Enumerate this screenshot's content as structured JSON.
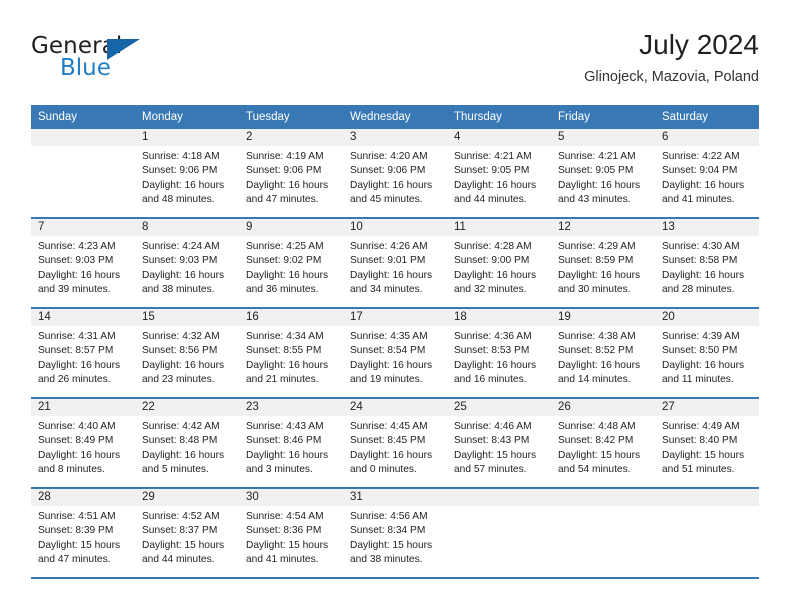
{
  "brand": {
    "name_part1": "General",
    "name_part2": "Blue",
    "triangle_color": "#1565a8",
    "blue_color": "#1f7fc6"
  },
  "header": {
    "title": "July 2024",
    "location": "Glinojeck, Mazovia, Poland"
  },
  "theme": {
    "header_blue": "#3878b4",
    "daynum_band": "#f1f1f1",
    "text": "#231f20"
  },
  "weekday_headers": [
    "Sunday",
    "Monday",
    "Tuesday",
    "Wednesday",
    "Thursday",
    "Friday",
    "Saturday"
  ],
  "weeks": [
    [
      {
        "day": "",
        "lines": []
      },
      {
        "day": "1",
        "lines": [
          "Sunrise: 4:18 AM",
          "Sunset: 9:06 PM",
          "Daylight: 16 hours",
          "and 48 minutes."
        ]
      },
      {
        "day": "2",
        "lines": [
          "Sunrise: 4:19 AM",
          "Sunset: 9:06 PM",
          "Daylight: 16 hours",
          "and 47 minutes."
        ]
      },
      {
        "day": "3",
        "lines": [
          "Sunrise: 4:20 AM",
          "Sunset: 9:06 PM",
          "Daylight: 16 hours",
          "and 45 minutes."
        ]
      },
      {
        "day": "4",
        "lines": [
          "Sunrise: 4:21 AM",
          "Sunset: 9:05 PM",
          "Daylight: 16 hours",
          "and 44 minutes."
        ]
      },
      {
        "day": "5",
        "lines": [
          "Sunrise: 4:21 AM",
          "Sunset: 9:05 PM",
          "Daylight: 16 hours",
          "and 43 minutes."
        ]
      },
      {
        "day": "6",
        "lines": [
          "Sunrise: 4:22 AM",
          "Sunset: 9:04 PM",
          "Daylight: 16 hours",
          "and 41 minutes."
        ]
      }
    ],
    [
      {
        "day": "7",
        "lines": [
          "Sunrise: 4:23 AM",
          "Sunset: 9:03 PM",
          "Daylight: 16 hours",
          "and 39 minutes."
        ]
      },
      {
        "day": "8",
        "lines": [
          "Sunrise: 4:24 AM",
          "Sunset: 9:03 PM",
          "Daylight: 16 hours",
          "and 38 minutes."
        ]
      },
      {
        "day": "9",
        "lines": [
          "Sunrise: 4:25 AM",
          "Sunset: 9:02 PM",
          "Daylight: 16 hours",
          "and 36 minutes."
        ]
      },
      {
        "day": "10",
        "lines": [
          "Sunrise: 4:26 AM",
          "Sunset: 9:01 PM",
          "Daylight: 16 hours",
          "and 34 minutes."
        ]
      },
      {
        "day": "11",
        "lines": [
          "Sunrise: 4:28 AM",
          "Sunset: 9:00 PM",
          "Daylight: 16 hours",
          "and 32 minutes."
        ]
      },
      {
        "day": "12",
        "lines": [
          "Sunrise: 4:29 AM",
          "Sunset: 8:59 PM",
          "Daylight: 16 hours",
          "and 30 minutes."
        ]
      },
      {
        "day": "13",
        "lines": [
          "Sunrise: 4:30 AM",
          "Sunset: 8:58 PM",
          "Daylight: 16 hours",
          "and 28 minutes."
        ]
      }
    ],
    [
      {
        "day": "14",
        "lines": [
          "Sunrise: 4:31 AM",
          "Sunset: 8:57 PM",
          "Daylight: 16 hours",
          "and 26 minutes."
        ]
      },
      {
        "day": "15",
        "lines": [
          "Sunrise: 4:32 AM",
          "Sunset: 8:56 PM",
          "Daylight: 16 hours",
          "and 23 minutes."
        ]
      },
      {
        "day": "16",
        "lines": [
          "Sunrise: 4:34 AM",
          "Sunset: 8:55 PM",
          "Daylight: 16 hours",
          "and 21 minutes."
        ]
      },
      {
        "day": "17",
        "lines": [
          "Sunrise: 4:35 AM",
          "Sunset: 8:54 PM",
          "Daylight: 16 hours",
          "and 19 minutes."
        ]
      },
      {
        "day": "18",
        "lines": [
          "Sunrise: 4:36 AM",
          "Sunset: 8:53 PM",
          "Daylight: 16 hours",
          "and 16 minutes."
        ]
      },
      {
        "day": "19",
        "lines": [
          "Sunrise: 4:38 AM",
          "Sunset: 8:52 PM",
          "Daylight: 16 hours",
          "and 14 minutes."
        ]
      },
      {
        "day": "20",
        "lines": [
          "Sunrise: 4:39 AM",
          "Sunset: 8:50 PM",
          "Daylight: 16 hours",
          "and 11 minutes."
        ]
      }
    ],
    [
      {
        "day": "21",
        "lines": [
          "Sunrise: 4:40 AM",
          "Sunset: 8:49 PM",
          "Daylight: 16 hours",
          "and 8 minutes."
        ]
      },
      {
        "day": "22",
        "lines": [
          "Sunrise: 4:42 AM",
          "Sunset: 8:48 PM",
          "Daylight: 16 hours",
          "and 5 minutes."
        ]
      },
      {
        "day": "23",
        "lines": [
          "Sunrise: 4:43 AM",
          "Sunset: 8:46 PM",
          "Daylight: 16 hours",
          "and 3 minutes."
        ]
      },
      {
        "day": "24",
        "lines": [
          "Sunrise: 4:45 AM",
          "Sunset: 8:45 PM",
          "Daylight: 16 hours",
          "and 0 minutes."
        ]
      },
      {
        "day": "25",
        "lines": [
          "Sunrise: 4:46 AM",
          "Sunset: 8:43 PM",
          "Daylight: 15 hours",
          "and 57 minutes."
        ]
      },
      {
        "day": "26",
        "lines": [
          "Sunrise: 4:48 AM",
          "Sunset: 8:42 PM",
          "Daylight: 15 hours",
          "and 54 minutes."
        ]
      },
      {
        "day": "27",
        "lines": [
          "Sunrise: 4:49 AM",
          "Sunset: 8:40 PM",
          "Daylight: 15 hours",
          "and 51 minutes."
        ]
      }
    ],
    [
      {
        "day": "28",
        "lines": [
          "Sunrise: 4:51 AM",
          "Sunset: 8:39 PM",
          "Daylight: 15 hours",
          "and 47 minutes."
        ]
      },
      {
        "day": "29",
        "lines": [
          "Sunrise: 4:52 AM",
          "Sunset: 8:37 PM",
          "Daylight: 15 hours",
          "and 44 minutes."
        ]
      },
      {
        "day": "30",
        "lines": [
          "Sunrise: 4:54 AM",
          "Sunset: 8:36 PM",
          "Daylight: 15 hours",
          "and 41 minutes."
        ]
      },
      {
        "day": "31",
        "lines": [
          "Sunrise: 4:56 AM",
          "Sunset: 8:34 PM",
          "Daylight: 15 hours",
          "and 38 minutes."
        ]
      },
      {
        "day": "",
        "lines": []
      },
      {
        "day": "",
        "lines": []
      },
      {
        "day": "",
        "lines": []
      }
    ]
  ]
}
